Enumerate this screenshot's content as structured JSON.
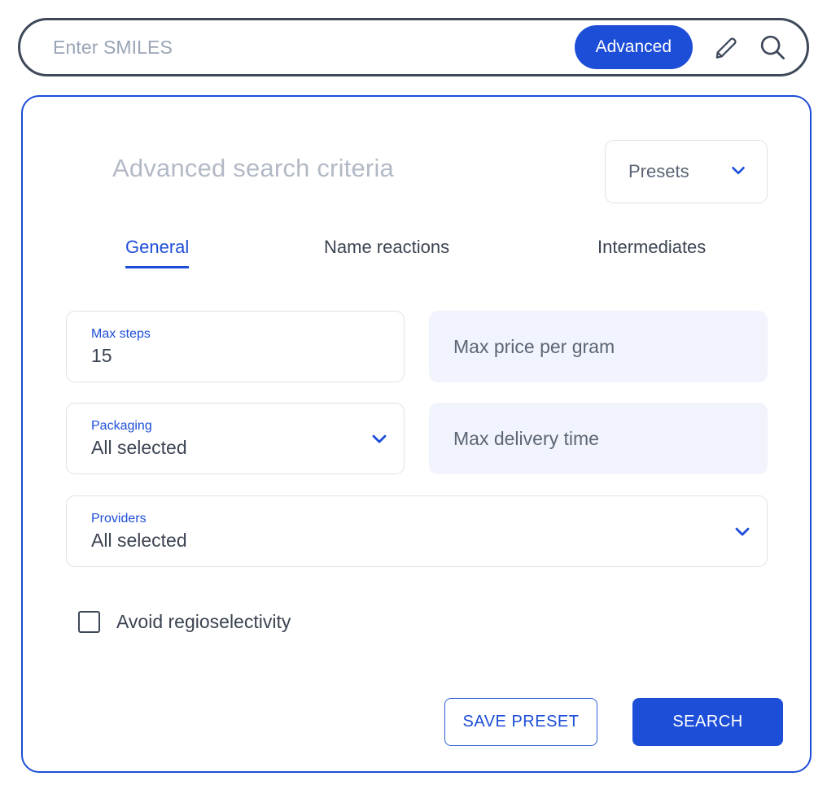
{
  "colors": {
    "accent_blue": "#1d4ed8",
    "dark_slate": "#3d4859",
    "muted_text": "#b3bac6",
    "filled_field_bg": "#f1f4fc",
    "field_border": "#dfe2e8"
  },
  "search_bar": {
    "input_value": "",
    "input_placeholder": "Enter SMILES",
    "advanced_label": "Advanced",
    "edit_icon": "pencil-icon",
    "search_icon": "search-icon"
  },
  "panel": {
    "title": "Advanced search criteria",
    "presets": {
      "label": "Presets",
      "chevron_icon": "chevron-down-icon"
    },
    "tabs": [
      {
        "label": "General",
        "active": true
      },
      {
        "label": "Name reactions",
        "active": false
      },
      {
        "label": "Intermediates",
        "active": false
      }
    ],
    "fields": {
      "max_steps": {
        "label": "Max steps",
        "value": "15",
        "style": "outlined"
      },
      "max_price_per_gram": {
        "placeholder": "Max price per gram",
        "value": "",
        "style": "filled"
      },
      "packaging": {
        "label": "Packaging",
        "value": "All selected",
        "style": "outlined",
        "chevron_icon": "chevron-down-icon"
      },
      "max_delivery_time": {
        "placeholder": "Max delivery time",
        "value": "",
        "style": "filled"
      },
      "providers": {
        "label": "Providers",
        "value": "All selected",
        "style": "outlined",
        "chevron_icon": "chevron-down-icon"
      }
    },
    "checkbox": {
      "label": "Avoid regioselectivity",
      "checked": false
    },
    "actions": {
      "save_preset_label": "SAVE PRESET",
      "search_label": "SEARCH"
    }
  }
}
